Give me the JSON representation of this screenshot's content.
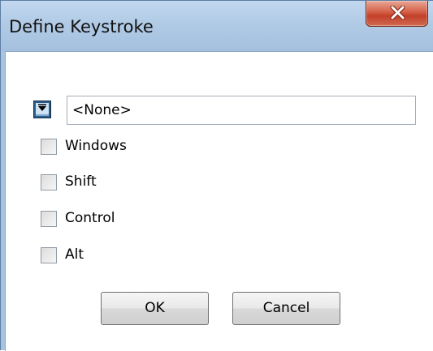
{
  "window": {
    "title": "Define Keystroke"
  },
  "icons": {
    "close": "close-icon",
    "key_dropdown": "keyboard-key-icon"
  },
  "key": {
    "value": "<None>"
  },
  "modifiers": [
    {
      "label": "Windows",
      "checked": false
    },
    {
      "label": "Shift",
      "checked": false
    },
    {
      "label": "Control",
      "checked": false
    },
    {
      "label": "Alt",
      "checked": false
    }
  ],
  "buttons": {
    "ok_label": "OK",
    "cancel_label": "Cancel"
  },
  "colors": {
    "titlebar": "#b1cbe6",
    "close_button": "#c4402a"
  }
}
